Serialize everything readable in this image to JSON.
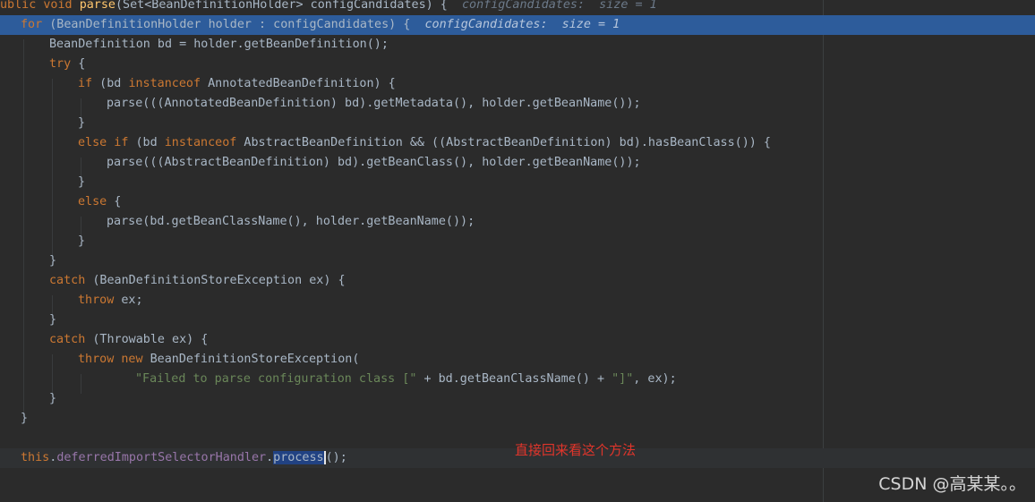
{
  "editor": {
    "line_header": {
      "part1": "ublic void ",
      "method": "parse",
      "part2": "(Set<BeanDefinitionHolder> configCandidates) {",
      "hint": "configCandidates:  size = 1"
    },
    "line_for": {
      "kw": "for",
      "part": " (BeanDefinitionHolder holder : configCandidates) {",
      "hint": "configCandidates:  size = 1"
    },
    "line_bd": "BeanDefinition bd = holder.getBeanDefinition();",
    "kw_try": "try",
    "brace_open": " {",
    "brace_close": "}",
    "kw_if": "if",
    "if_part1": " (bd ",
    "kw_instanceof": "instanceof",
    "if_part2": " AnnotatedBeanDefinition) {",
    "parse1": "parse(((AnnotatedBeanDefinition) bd).getMetadata(), holder.getBeanName());",
    "kw_else_if": "else if",
    "else_if_part1": " (bd ",
    "else_if_part2": " AbstractBeanDefinition && ((AbstractBeanDefinition) bd).hasBeanClass()) {",
    "parse2": "parse(((AbstractBeanDefinition) bd).getBeanClass(), holder.getBeanName());",
    "kw_else": "else",
    "parse3": "parse(bd.getBeanClassName(), holder.getBeanName());",
    "kw_catch": "catch",
    "catch1_part": " (BeanDefinitionStoreException ex) {",
    "kw_throw": "throw",
    "throw_part": " ex;",
    "catch2_part": " (Throwable ex) {",
    "kw_new": "new",
    "throw_new_part": " BeanDefinitionStoreException(",
    "str_failed": "\"Failed to parse configuration class [\"",
    "concat_part": " + bd.getBeanClassName() + ",
    "str_close": "\"]\"",
    "tail_part": ", ex);",
    "kw_this": "this",
    "dot": ".",
    "field": "deferredImportSelectorHandler",
    "method_sel": "process",
    "call_end": "();"
  },
  "annotation": "直接回来看这个方法",
  "watermark": "CSDN @高某某。。",
  "colors": {
    "background": "#2b2b2b",
    "keyword": "#cc7832",
    "method": "#ffc66d",
    "field": "#9876aa",
    "string": "#6a8759",
    "execution_line": "#2d5c9b",
    "annotation": "#e0352b"
  }
}
